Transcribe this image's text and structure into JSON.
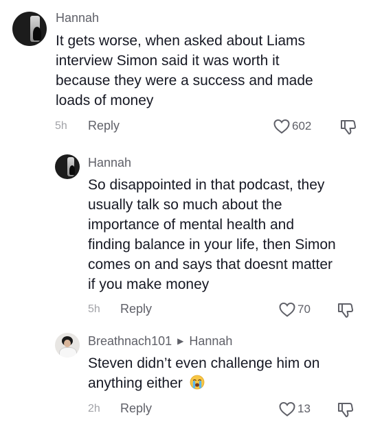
{
  "comments": [
    {
      "username": "Hannah",
      "text_lines": [
        "It gets worse, when asked about Liams",
        "interview Simon said it was worth it",
        "because they were a success and made",
        "loads of money"
      ],
      "time": "5h",
      "reply_label": "Reply",
      "likes": "602"
    },
    {
      "username": "Hannah",
      "text_lines": [
        "So disappointed in that podcast, they",
        "usually talk so much about the",
        "importance of mental health and",
        "finding balance in your life, then Simon",
        "comes on and says that doesnt matter",
        "if you make money"
      ],
      "time": "5h",
      "reply_label": "Reply",
      "likes": "70"
    },
    {
      "username": "Breathnach101",
      "replying_to": "Hannah",
      "text_lines": [
        "Steven didn’t even challenge him on",
        "anything either"
      ],
      "time": "2h",
      "reply_label": "Reply",
      "likes": "13",
      "emoji": "crying-face"
    }
  ],
  "icons": {
    "like": "heart-outline-icon",
    "dislike": "thumbs-down-outline-icon",
    "reply_arrow": "triangle-right-icon"
  }
}
